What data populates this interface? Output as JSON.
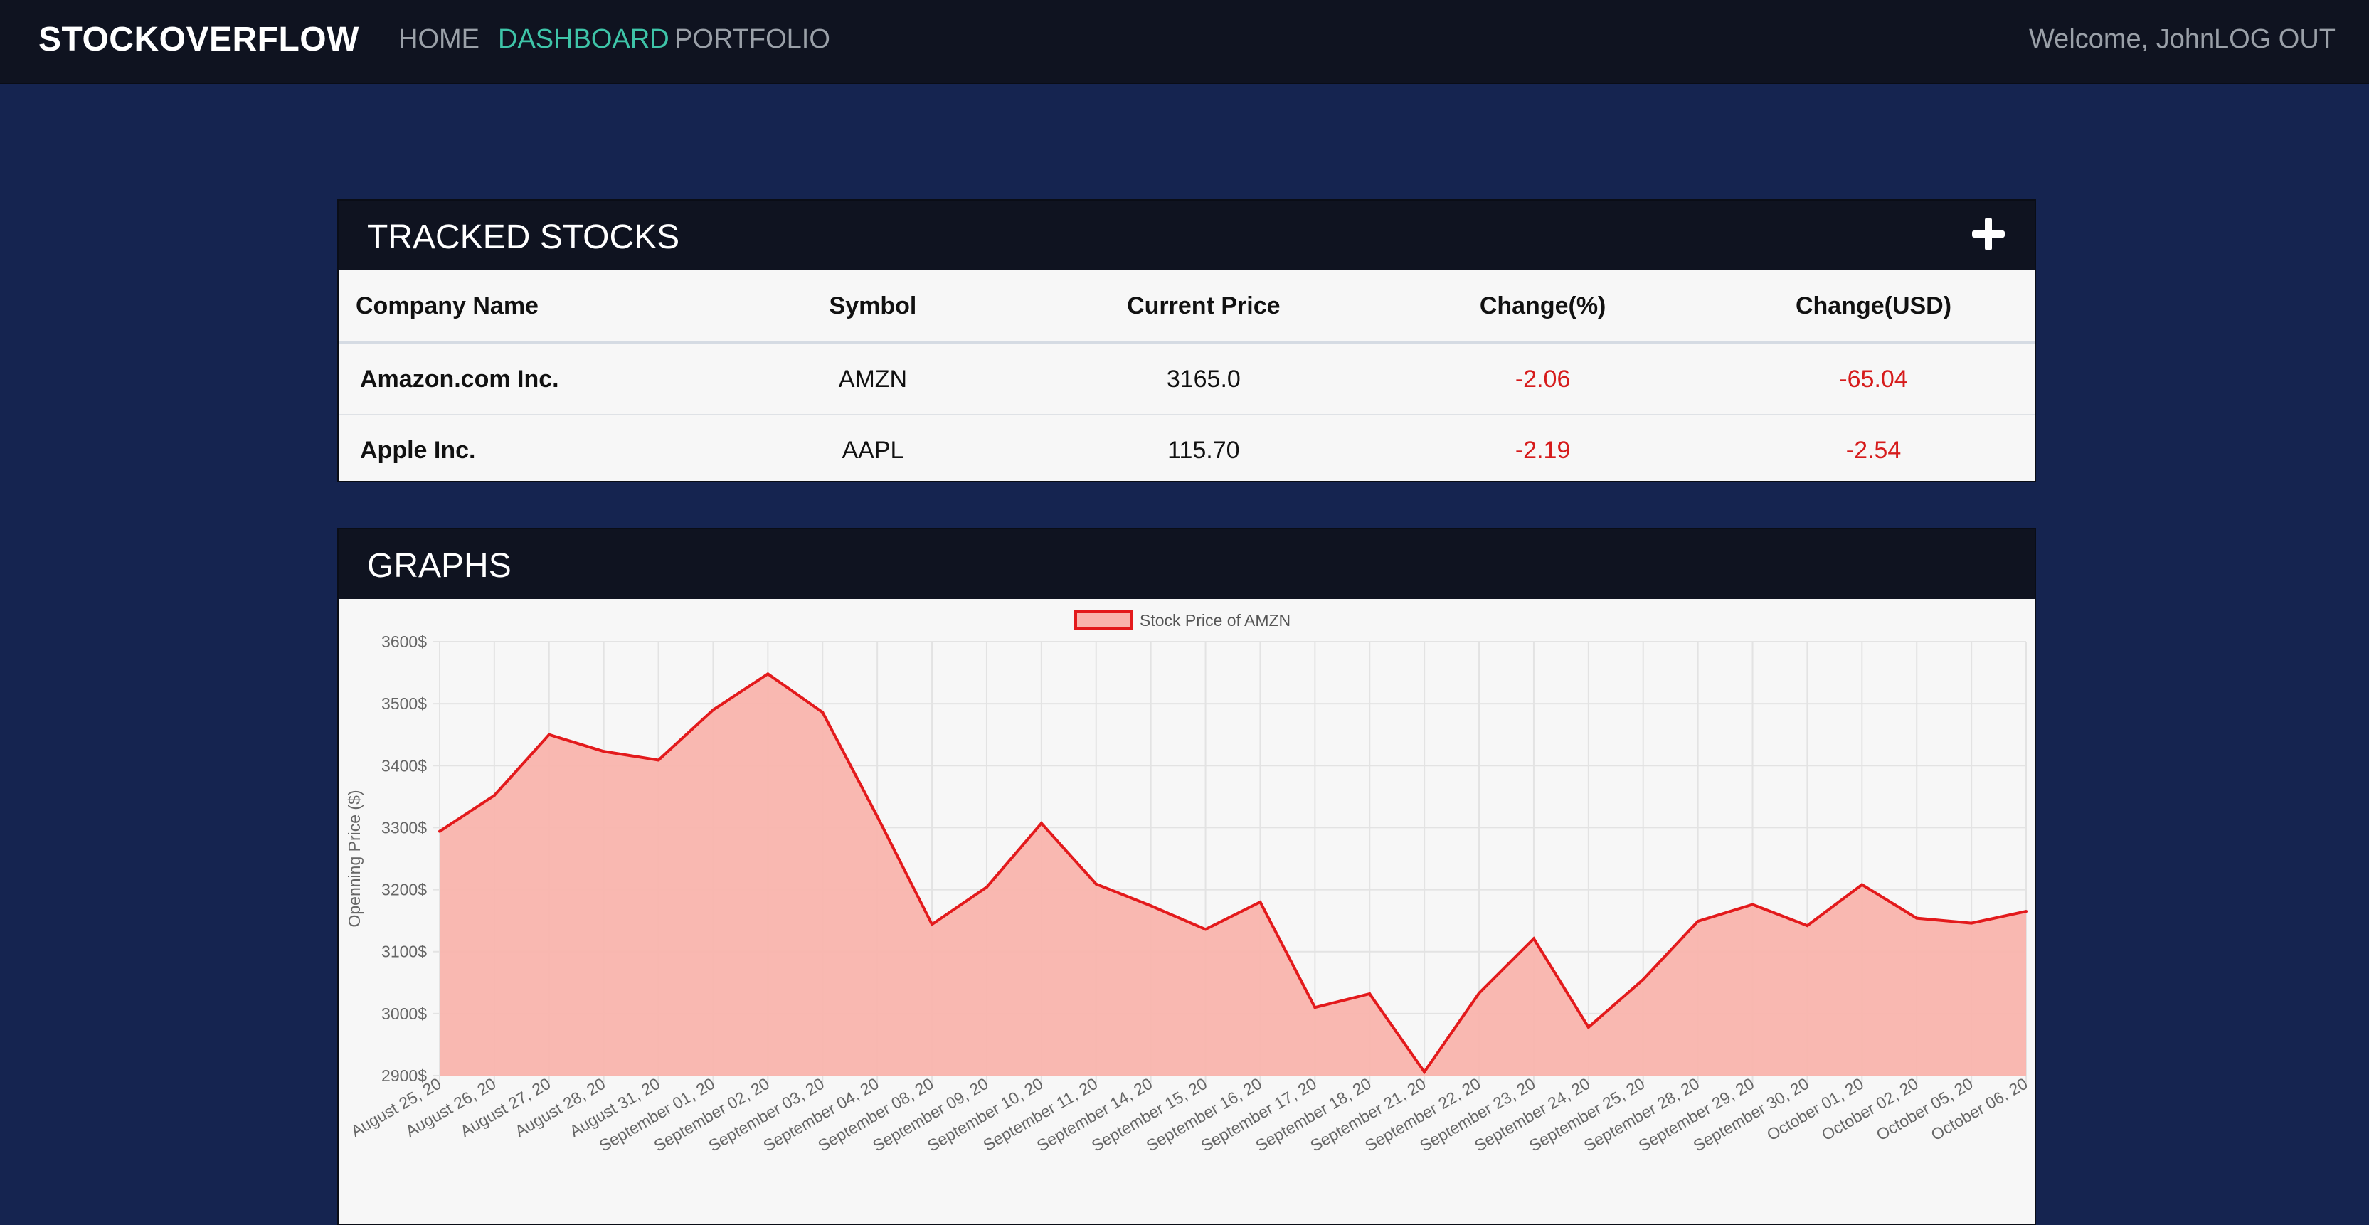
{
  "nav": {
    "brand": "STOCKOVERFLOW",
    "links": [
      "HOME",
      "DASHBOARD",
      "PORTFOLIO"
    ],
    "active": "DASHBOARD",
    "welcome": "Welcome, John",
    "logout": "LOG OUT"
  },
  "colors": {
    "accent": "#3ec4a8",
    "negative": "#d61b1b",
    "line": "#e31a1c",
    "fill": "#f9b4ad"
  },
  "tracked": {
    "title": "TRACKED STOCKS",
    "add_icon": "plus-icon",
    "columns": [
      "Company Name",
      "Symbol",
      "Current Price",
      "Change(%)",
      "Change(USD)"
    ],
    "rows": [
      {
        "company": "Amazon.com Inc.",
        "symbol": "AMZN",
        "price": "3165.0",
        "change_pct": "-2.06",
        "change_usd": "-65.04"
      },
      {
        "company": "Apple Inc.",
        "symbol": "AAPL",
        "price": "115.70",
        "change_pct": "-2.19",
        "change_usd": "-2.54"
      }
    ]
  },
  "graphs": {
    "title": "GRAPHS"
  },
  "chart_data": {
    "type": "area",
    "ylabel": "Openning Price ($)",
    "ylim": [
      2900,
      3600
    ],
    "yticks": [
      "3600$",
      "3500$",
      "3400$",
      "3300$",
      "3200$",
      "3100$",
      "3000$",
      "2900$"
    ],
    "grid": true,
    "legend_position": "top",
    "categories": [
      "August 25, 20",
      "August 26, 20",
      "August 27, 20",
      "August 28, 20",
      "August 31, 20",
      "September 01, 20",
      "September 02, 20",
      "September 03, 20",
      "September 04, 20",
      "September 08, 20",
      "September 09, 20",
      "September 10, 20",
      "September 11, 20",
      "September 14, 20",
      "September 15, 20",
      "September 16, 20",
      "September 17, 20",
      "September 18, 20",
      "September 21, 20",
      "September 22, 20",
      "September 23, 20",
      "September 24, 20",
      "September 25, 20",
      "September 28, 20",
      "September 29, 20",
      "September 30, 20",
      "October 01, 20",
      "October 02, 20",
      "October 05, 20",
      "October 06, 20"
    ],
    "series": [
      {
        "name": "Stock Price of AMZN",
        "values": [
          3294,
          3352,
          3450,
          3423,
          3409,
          3490,
          3548,
          3486,
          3318,
          3144,
          3204,
          3307,
          3209,
          3174,
          3136,
          3180,
          3010,
          3032,
          2906,
          3033,
          3121,
          2978,
          3055,
          3149,
          3176,
          3142,
          3208,
          3154,
          3146,
          3165
        ]
      }
    ]
  }
}
